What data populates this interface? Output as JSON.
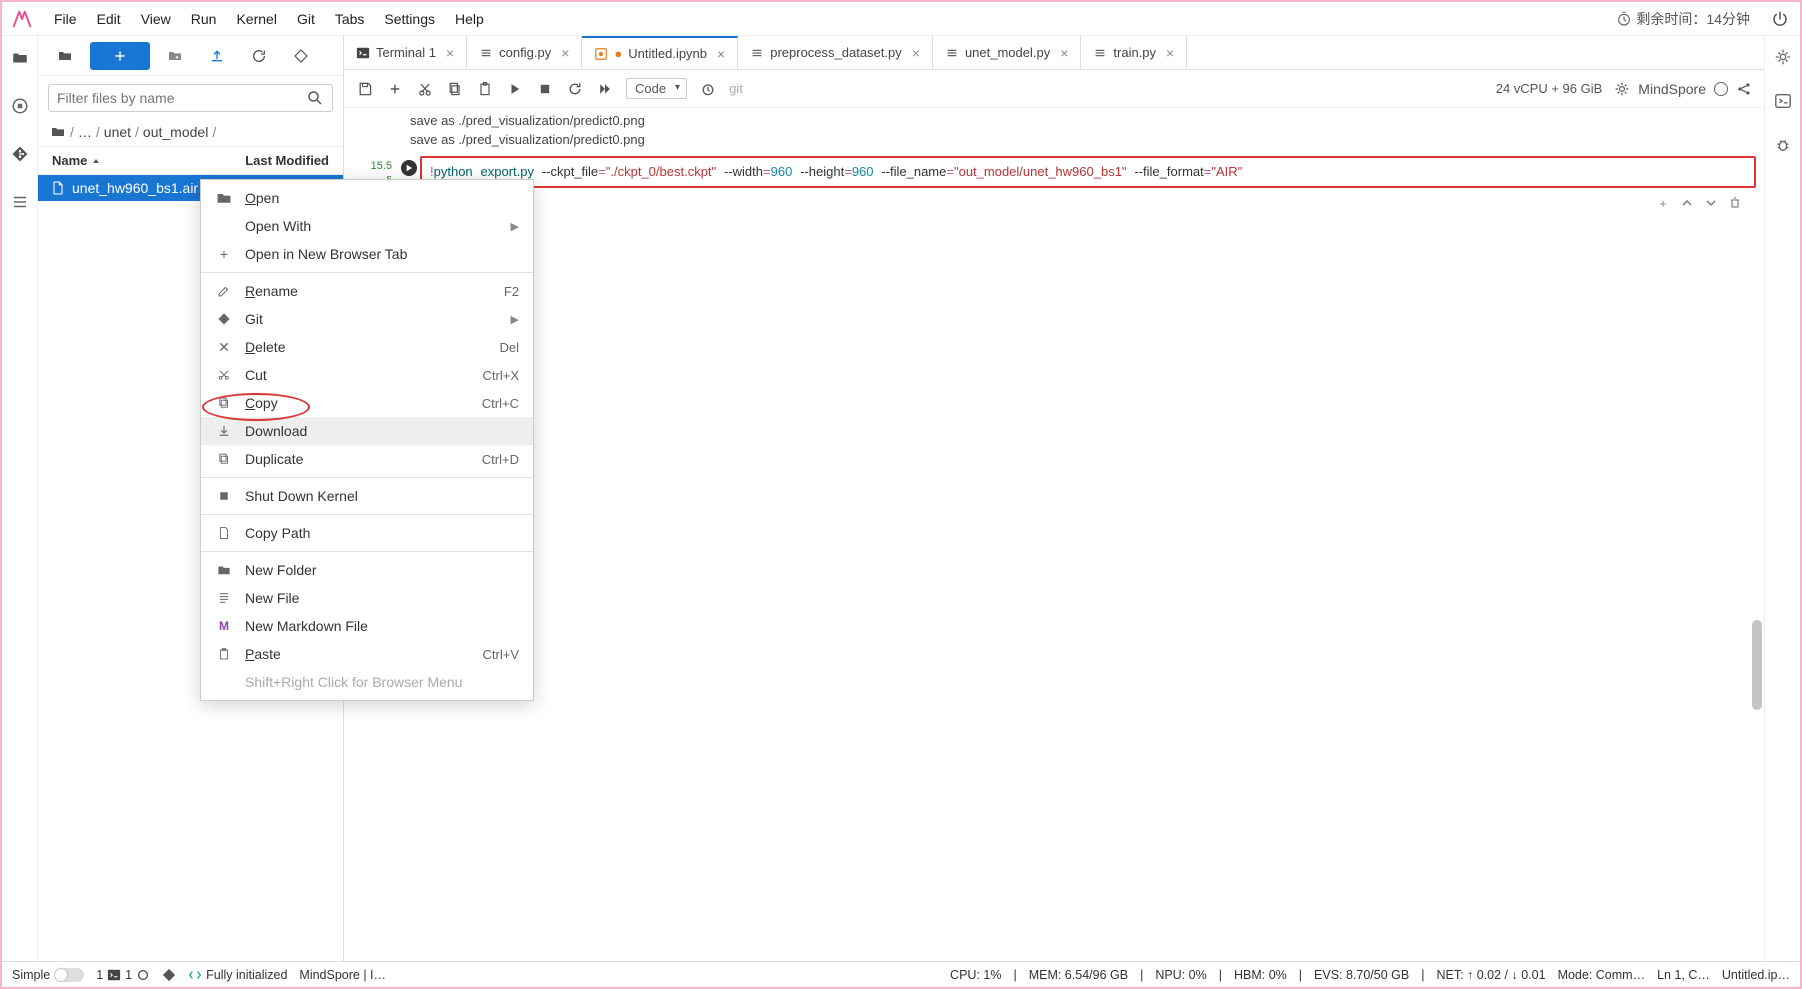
{
  "menubar": {
    "items": [
      "File",
      "Edit",
      "View",
      "Run",
      "Kernel",
      "Git",
      "Tabs",
      "Settings",
      "Help"
    ],
    "time_remaining": "剩余时间：14分钟"
  },
  "file_toolbar": {
    "filter_placeholder": "Filter files by name"
  },
  "breadcrumb": {
    "segments": [
      "",
      "…",
      "unet",
      "out_model",
      ""
    ]
  },
  "file_header": {
    "name": "Name",
    "modified": "Last Modified"
  },
  "files": [
    {
      "name": "unet_hw960_bs1.air"
    }
  ],
  "tabs": [
    {
      "label": "Terminal 1",
      "type": "term"
    },
    {
      "label": "config.py",
      "type": "py"
    },
    {
      "label": "Untitled.ipynb",
      "type": "nb",
      "active": true,
      "dirty": true
    },
    {
      "label": "preprocess_dataset.py",
      "type": "py"
    },
    {
      "label": "unet_model.py",
      "type": "py"
    },
    {
      "label": "train.py",
      "type": "py"
    }
  ],
  "nb_toolbar": {
    "cell_type": "Code",
    "git_label": "git",
    "resources": "24 vCPU + 96 GiB",
    "kernel_name": "MindSpore"
  },
  "output_lines": [
    "save as ./pred_visualization/predict0.png",
    "save as ./pred_visualization/predict0.png"
  ],
  "cell": {
    "timing": "15.5",
    "timing_unit": "s",
    "code_prefix": "!",
    "code_cmd1": "python",
    "code_cmd2": "export.py",
    "flag1": "--ckpt_file",
    "val1": "\"./ckpt_0/best.ckpt\"",
    "flag2": "--width",
    "val2": "960",
    "flag3": "--height",
    "val3": "960",
    "flag4": "--file_name",
    "val4": "\"out_model/unet_hw960_bs1\"",
    "flag5": "--file_format",
    "val5": "\"AIR\""
  },
  "context_menu": {
    "open": "Open",
    "open_with": "Open With",
    "open_new_tab": "Open in New Browser Tab",
    "rename": "Rename",
    "rename_k": "F2",
    "git": "Git",
    "delete": "Delete",
    "delete_k": "Del",
    "cut": "Cut",
    "cut_k": "Ctrl+X",
    "copy": "Copy",
    "copy_k": "Ctrl+C",
    "download": "Download",
    "duplicate": "Duplicate",
    "duplicate_k": "Ctrl+D",
    "shutdown": "Shut Down Kernel",
    "copy_path": "Copy Path",
    "new_folder": "New Folder",
    "new_file": "New File",
    "new_md": "New Markdown File",
    "paste": "Paste",
    "paste_k": "Ctrl+V",
    "hint": "Shift+Right Click for Browser Menu"
  },
  "statusbar": {
    "simple": "Simple",
    "count1": "1",
    "count2": "1",
    "init": "Fully initialized",
    "kernel": "MindSpore | I…",
    "cpu": "CPU:  1%",
    "mem": "MEM:  6.54/96 GB",
    "npu": "NPU:  0%",
    "hbm": "HBM:  0%",
    "evs": "EVS:  8.70/50 GB",
    "net": "NET:  ↑ 0.02  /  ↓ 0.01",
    "mode": "Mode: Comm…",
    "ln": "Ln 1, C…",
    "file": "Untitled.ip…"
  }
}
